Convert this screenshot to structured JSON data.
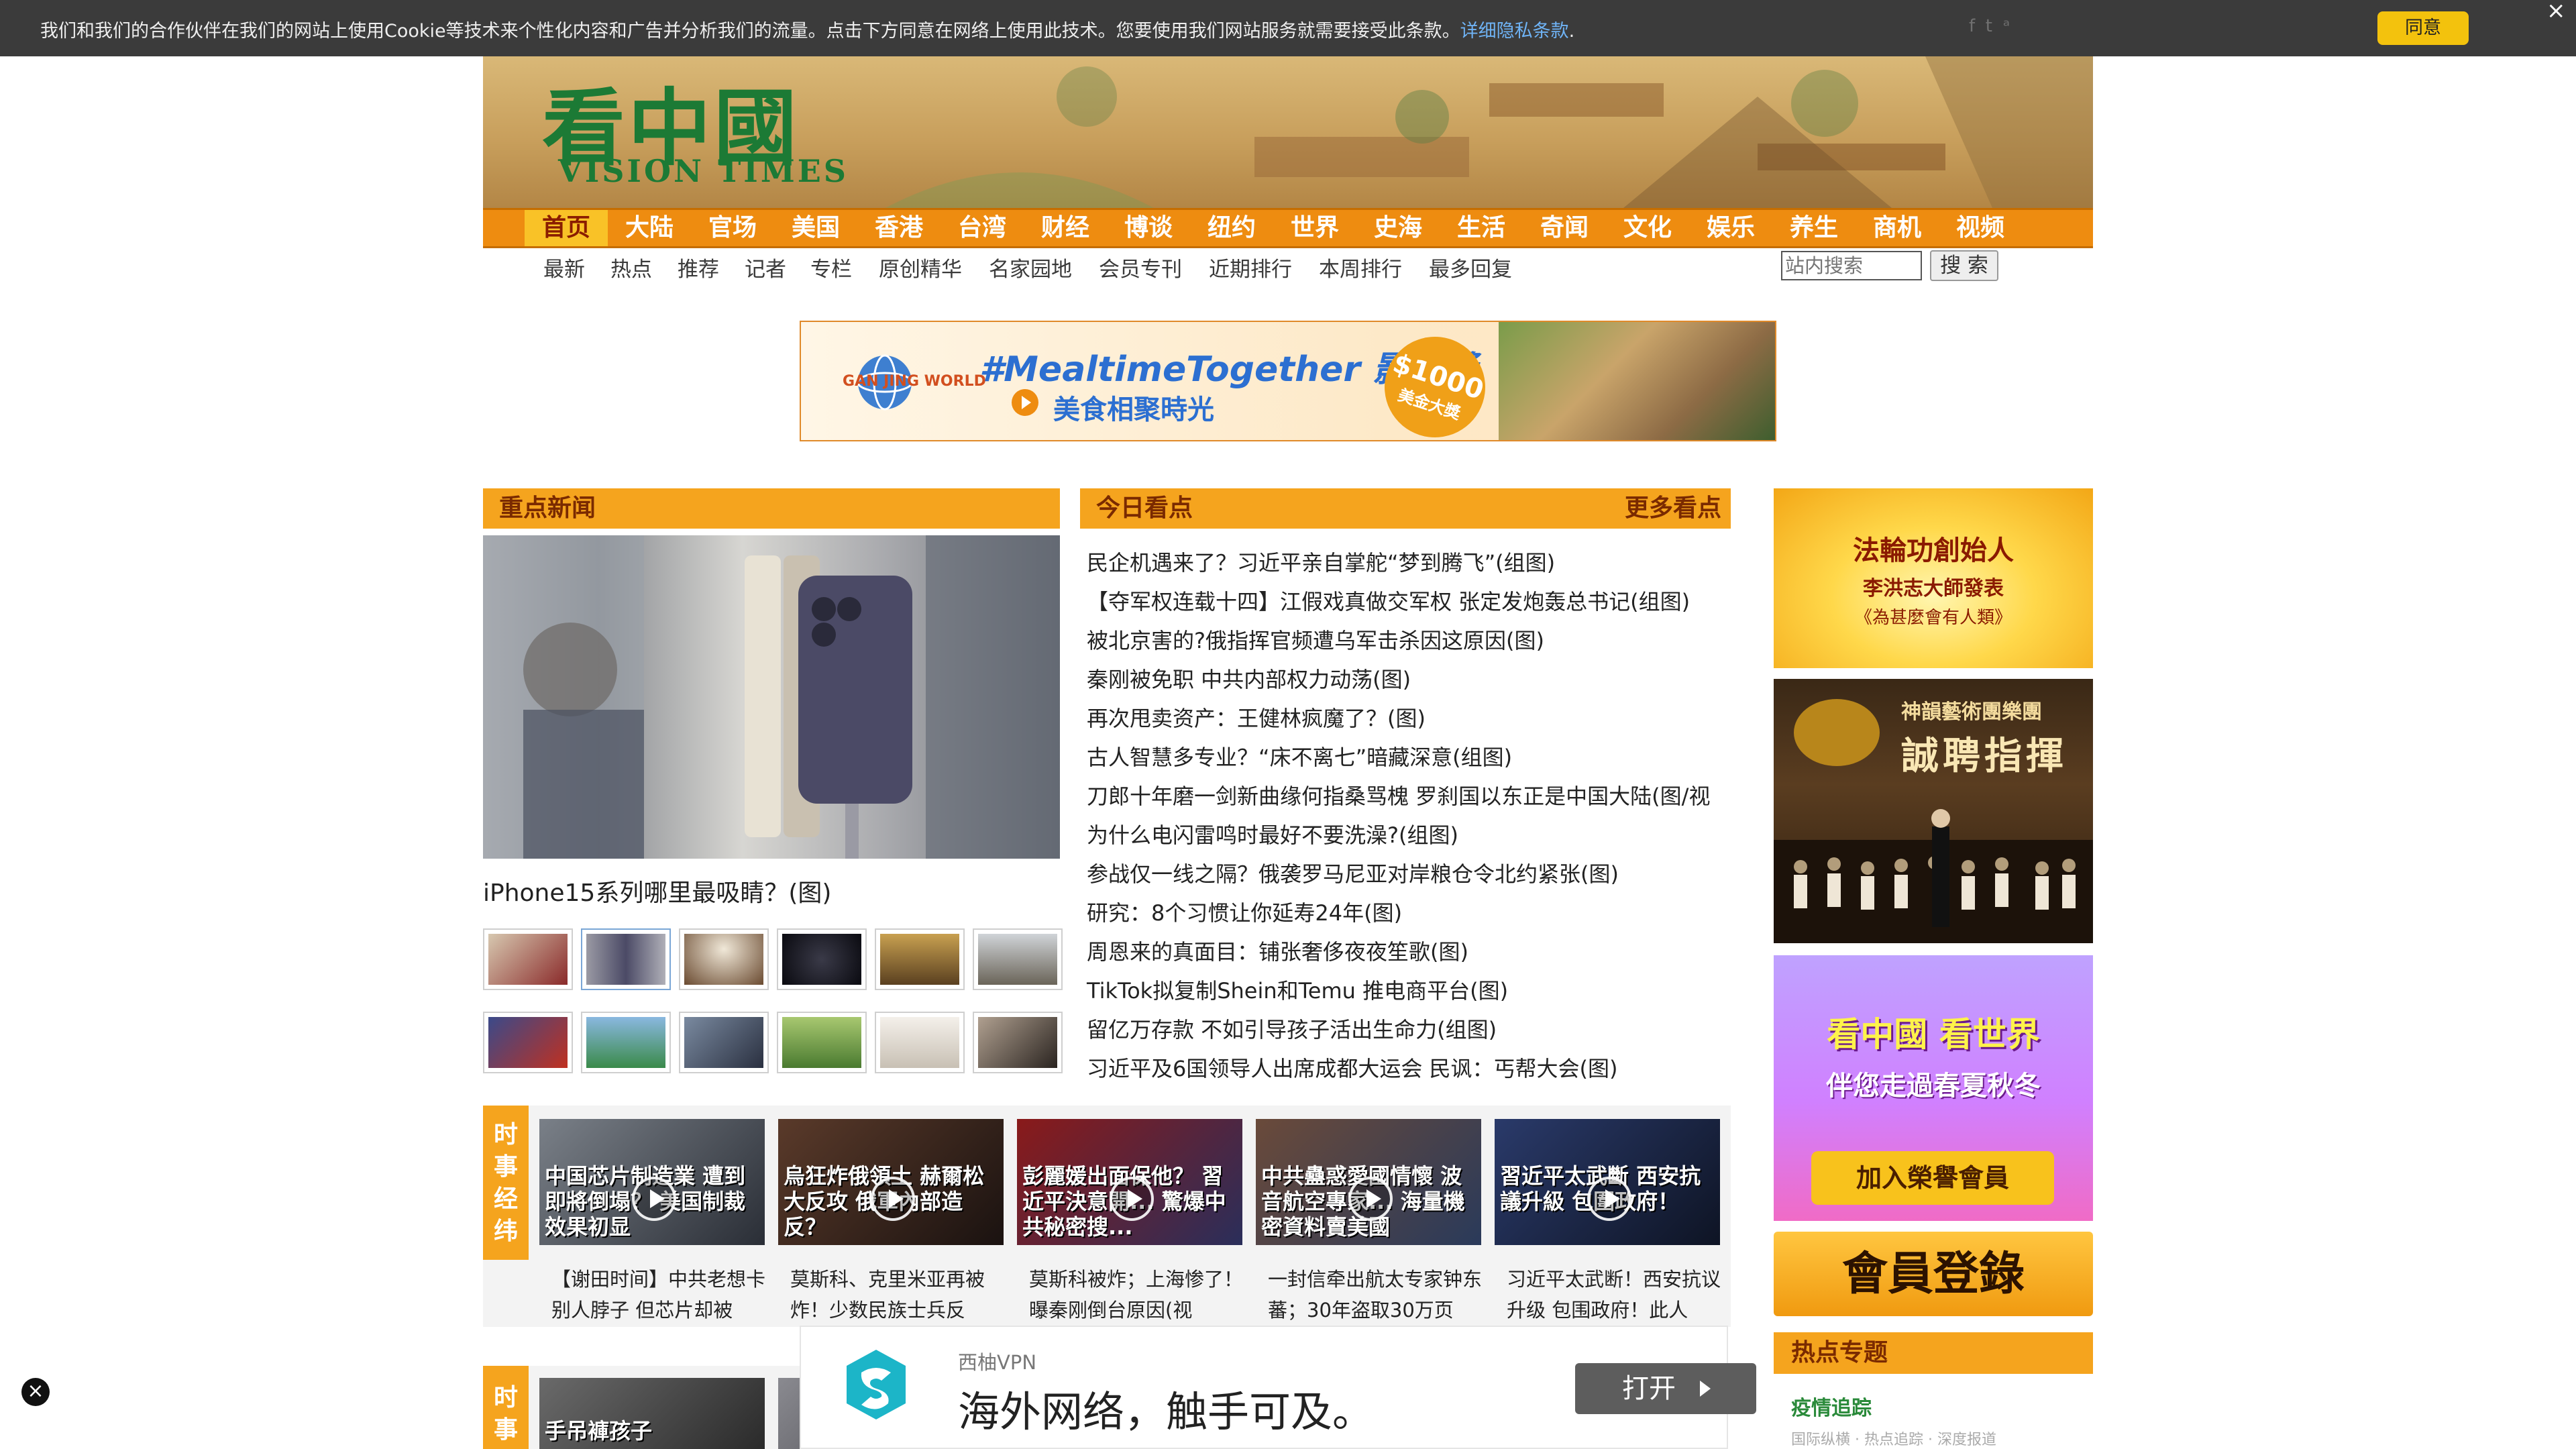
{
  "cookie_bar": {
    "text": "我们和我们的合作伙伴在我们的网站上使用Cookie等技术来个性化内容和广告并分析我们的流量。点击下方同意在网络上使用此技术。您要使用我们网站服务就需要接受此条款。",
    "link": "详细隐私条款",
    "after": ".",
    "agree": "同意",
    "close": "×",
    "social_icons": [
      "facebook-icon",
      "twitter-icon",
      "rss-icon"
    ]
  },
  "logo": {
    "cn": "看中國",
    "en": "VISION TIMES"
  },
  "nav": {
    "items": [
      "首页",
      "大陆",
      "官场",
      "美国",
      "香港",
      "台湾",
      "财经",
      "博谈",
      "纽约",
      "世界",
      "史海",
      "生活",
      "奇闻",
      "文化",
      "娱乐",
      "养生",
      "商机",
      "视频"
    ],
    "active": "首页"
  },
  "subnav": {
    "items": [
      "最新",
      "热点",
      "推荐",
      "记者",
      "专栏",
      "原创精华",
      "名家园地",
      "会员专刊",
      "近期排行",
      "本周排行",
      "最多回复"
    ]
  },
  "search": {
    "placeholder": "站内搜索",
    "button": "搜 索"
  },
  "ad_top": {
    "brand": "GAN JING WORLD",
    "title": "#MealtimeTogether 影片獎",
    "subtitle": "美食相聚時光",
    "prize_amount": "$1000",
    "prize_text": "美金大獎"
  },
  "focus": {
    "header": "重点新闻",
    "caption": "iPhone15系列哪里最吸睛？(图)"
  },
  "today": {
    "header": "今日看点",
    "more": "更多看点",
    "items": [
      "民企机遇来了？习近平亲自掌舵“梦到腾飞”(组图)",
      "【夺军权连载十四】江假戏真做交军权 张定发炮轰总书记(组图)",
      "被北京害的?俄指挥官频遭乌军击杀因这原因(图)",
      "秦刚被免职 中共内部权力动荡(图)",
      "再次甩卖资产：王健林疯魔了？(图)",
      "古人智慧多专业？“床不离七”暗藏深意(组图)",
      "刀郎十年磨一剑新曲缘何指桑骂槐 罗刹国以东正是中国大陆(图/视",
      "为什么电闪雷鸣时最好不要洗澡?(组图)",
      "参战仅一线之隔？俄袭罗马尼亚对岸粮仓令北约紧张(图)",
      "研究：8个习惯让你延寿24年(图)",
      "周恩来的真面目：铺张奢侈夜夜笙歌(图)",
      "TikTok拟复制Shein和Temu 推电商平台(图)",
      "留亿万存款 不如引导孩子活出生命力(组图)",
      "习近平及6国领导人出席成都大运会 民讽：丐帮大会(图)"
    ]
  },
  "video": {
    "tag": "时事经纬",
    "tag2": "时事",
    "cards": [
      {
        "thumb_text": "中国芯片制造業 遭到即將倒塌？ 美国制裁效果初显",
        "caption": "【谢田时间】中共老想卡别人脖子 但芯片却被"
      },
      {
        "thumb_text": "烏狂炸俄領土 赫爾松大反攻 俄軍內部造反？",
        "caption": "莫斯科、克里米亚再被炸！少数民族士兵反"
      },
      {
        "thumb_text": "彭麗媛出面保他？ 習近平決意開... 驚爆中共秘密搜... ",
        "caption": "莫斯科被炸；上海惨了！曝秦刚倒台原因(视"
      },
      {
        "thumb_text": "中共蠱惑愛國情懷 波音航空專家... 海量機密資料賣美國",
        "caption": "一封信牵出航太专家钟东蕃；30年盗取30万页"
      },
      {
        "thumb_text": "習近平太武斷 西安抗議升級 包圍政府！",
        "caption": "习近平太武断！西安抗议升级 包围政府！此人"
      }
    ],
    "row2_thumb_text": "手吊褲孩子"
  },
  "sidebar": {
    "falun_1": "法輪功創始人",
    "falun_2": "李洪志大師發表",
    "falun_3": "《為甚麼會有人類》",
    "shenyun_org": "神韻藝術團樂團",
    "shenyun_title": "誠聘指揮",
    "kzg_1": "看中國 看世界",
    "kzg_2": "伴您走過春夏秋冬",
    "kzg_btn": "加入榮譽會員",
    "login": "會員登錄",
    "hot_header": "热点专题",
    "hot_item_1": "疫情追踪",
    "hot_item_2": "国际纵横 · 热点追踪 · 深度报道"
  },
  "vpn": {
    "name": "西柚VPN",
    "slogan": "海外网络，触手可及。",
    "open": "打开"
  },
  "close_btn": "×",
  "colors": {
    "nav": "#ee8c10",
    "section": "#f5a41e",
    "accent_yellow": "#f3c20d",
    "logo_green": "#1c7a35"
  }
}
